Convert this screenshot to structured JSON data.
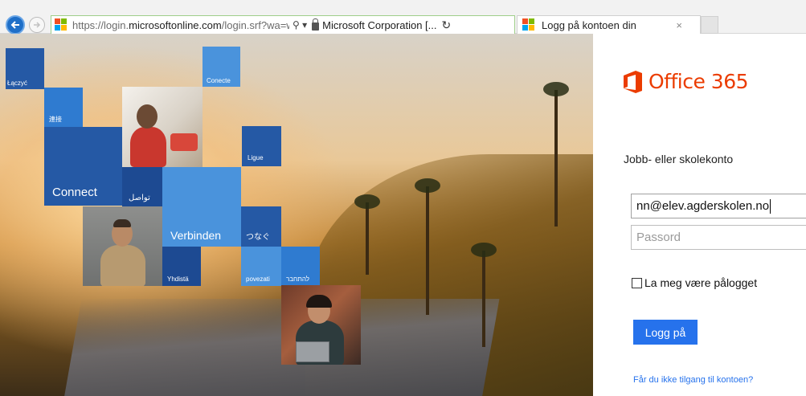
{
  "browser": {
    "url_prefix": "https://login.",
    "url_domain": "microsoftonline.com",
    "url_path": "/login.srf?wa=wsignin",
    "search_glyph": "⚲ ▾",
    "certificate_label": "Microsoft Corporation [...",
    "refresh_glyph": "↻",
    "tab_title": "Logg på kontoen din",
    "tab_close": "×"
  },
  "hero": {
    "tiles": {
      "laczyc": "Łączyć",
      "conecte": "Conecte",
      "lianjie": "連接",
      "ligue": "Ligue",
      "connect": "Connect",
      "tawasal": "تواصل",
      "verbinden": "Verbinden",
      "tsunagu": "つなぐ",
      "yhdista": "Yhdistä",
      "povezati": "povezati",
      "lehitchaber": "להתחבר"
    }
  },
  "login": {
    "brand": "Office 365",
    "account_label": "Jobb- eller skolekonto",
    "email_value": "nn@elev.agderskolen.no",
    "password_placeholder": "Passord",
    "keep_signed_in": "La meg være pålogget",
    "sign_in_button": "Logg på",
    "cant_access_link": "Får du ikke tilgang til kontoen?"
  },
  "colors": {
    "ms_red": "#f25022",
    "ms_green": "#7fba00",
    "ms_blue": "#00a4ef",
    "ms_yellow": "#ffb900",
    "office_orange": "#eb3c00",
    "accent_blue": "#2672ec"
  }
}
